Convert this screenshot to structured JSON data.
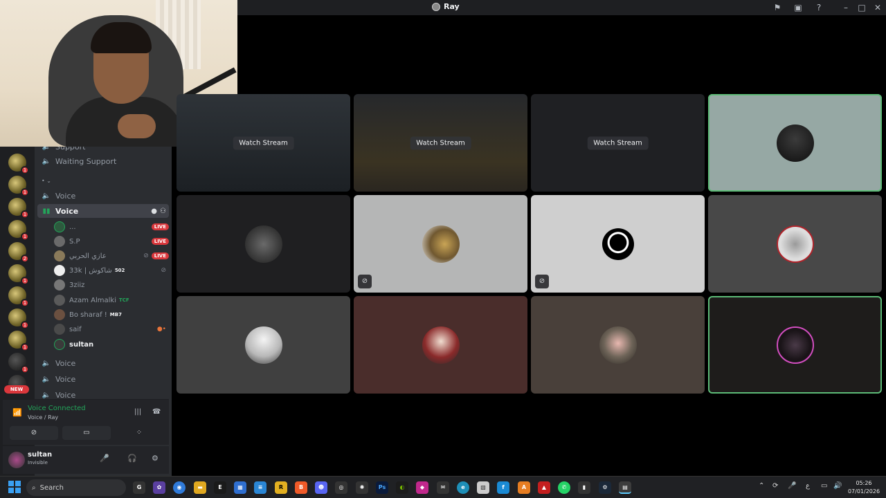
{
  "window": {
    "title": "Ray"
  },
  "channels": {
    "support_partial": "Support",
    "waiting_support": "Waiting Support",
    "voice_active": "Voice",
    "voice_1": "Voice",
    "voice_2": "Voice",
    "voice_3": "Voice",
    "voice_4": "Voice"
  },
  "voice_users": [
    {
      "name": "...",
      "live": "LIVE"
    },
    {
      "name": "S.P",
      "live": "LIVE"
    },
    {
      "name": "عازي الحربي",
      "live": "LIVE"
    },
    {
      "name": "33k | شاكوش",
      "tag": "502"
    },
    {
      "name": "3ziiz"
    },
    {
      "name": "Azam Almalki",
      "tag": "TCF"
    },
    {
      "name": "Bo sharaf !",
      "tag": "MB7"
    },
    {
      "name": "saif"
    },
    {
      "name": "sultan"
    }
  ],
  "rail": {
    "new_label": "NEW",
    "badges": [
      "1",
      "1",
      "1",
      "1",
      "2",
      "1",
      "1",
      "1",
      "1",
      "1"
    ]
  },
  "voice_panel": {
    "status": "Voice Connected",
    "channel": "Voice / Ray"
  },
  "user_panel": {
    "name": "sultan",
    "status": "Invisible"
  },
  "grid": {
    "watch_label": "Watch Stream"
  },
  "taskbar": {
    "search_placeholder": "Search",
    "time": "05:26",
    "date": "07/01/2026",
    "lang": "ع"
  },
  "colors": {
    "accent_green": "#23a55a",
    "live_red": "#da373c",
    "speaking_outline": "#5dbb77"
  }
}
